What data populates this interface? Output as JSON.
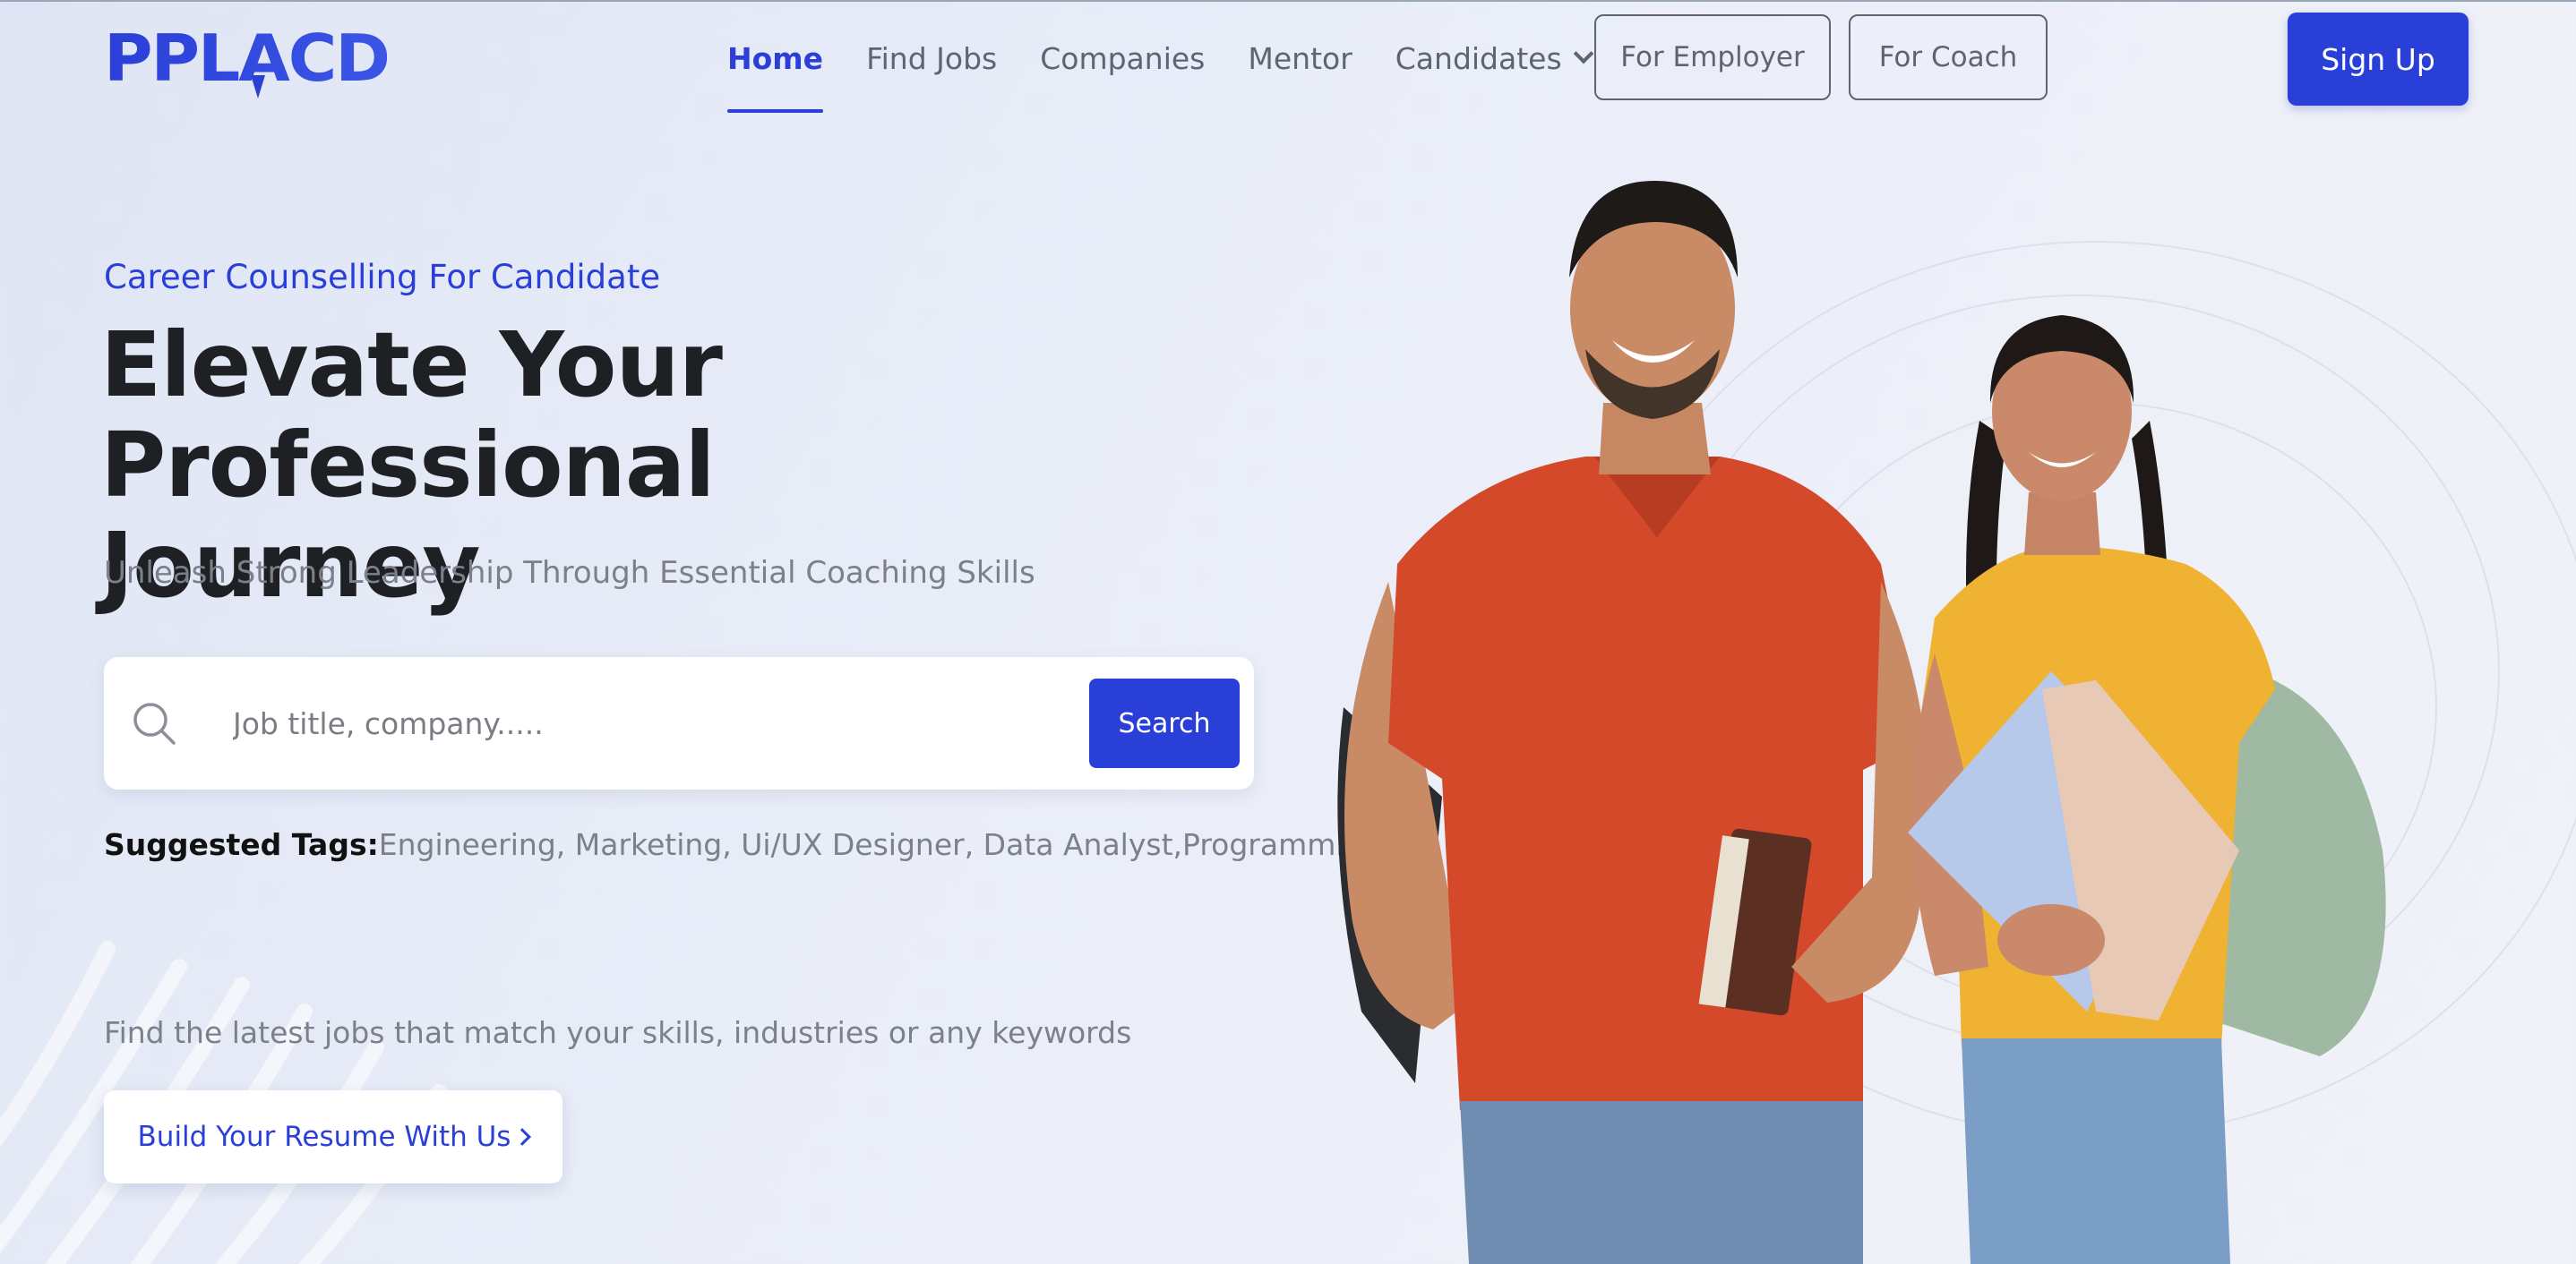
{
  "brand": {
    "logo_text": "PPLACD",
    "primary_color": "#2a3fd8"
  },
  "nav": {
    "items": [
      {
        "label": "Home",
        "active": true
      },
      {
        "label": "Find Jobs",
        "active": false
      },
      {
        "label": "Companies",
        "active": false
      },
      {
        "label": "Mentor",
        "active": false
      },
      {
        "label": "Candidates",
        "active": false,
        "has_dropdown": true
      }
    ],
    "employer_label": "For Employer",
    "coach_label": "For Coach",
    "signup_label": "Sign Up"
  },
  "hero": {
    "eyebrow": "Career Counselling For Candidate",
    "headline_line1": "Elevate Your Professional",
    "headline_line2": "Journey",
    "subline": "Unleash Strong Leadership Through Essential Coaching Skills",
    "search": {
      "placeholder": "Job title, company.....",
      "value": "",
      "button_label": "Search",
      "icon": "search-icon"
    },
    "tags_label": "Suggested Tags:",
    "tags_text": "Engineering, Marketing, Ui/UX Designer, Data Analyst,Programming",
    "find_latest": "Find the latest jobs that match your skills, industries or any keywords",
    "resume_button_label": "Build Your Resume With Us"
  }
}
